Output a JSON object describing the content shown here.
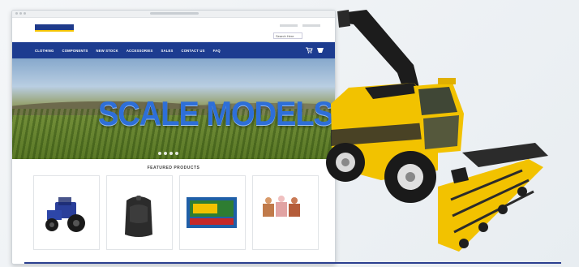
{
  "site": {
    "search_placeholder": "Search Here"
  },
  "nav": {
    "items": [
      "CLOTHING",
      "COMPONENTS",
      "NEW STOCK",
      "ACCESSORIES",
      "SALES",
      "CONTACT US",
      "FAQ"
    ]
  },
  "hero": {
    "title": "SCALE MODELS"
  },
  "featured": {
    "title": "FEATURED PRODUCTS",
    "products": [
      "blue-tractor",
      "black-backpack",
      "boxed-model",
      "toy-figures"
    ]
  },
  "colors": {
    "nav": "#1d3c90",
    "hero_text": "#2e6fd8",
    "accent_yellow": "#f2c200",
    "underline": "#2b3f8f"
  }
}
